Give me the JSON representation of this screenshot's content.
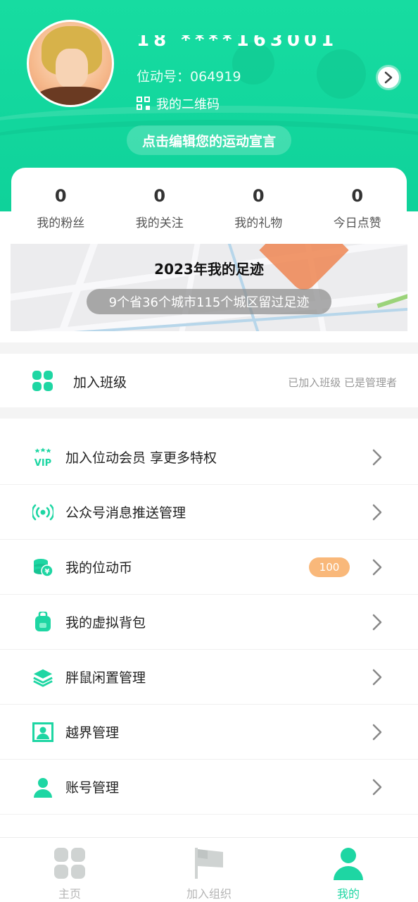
{
  "colors": {
    "primary": "#17dca1",
    "badge": "#f9b87a",
    "text": "#222222",
    "muted": "#999999"
  },
  "header": {
    "nickname": "18 ****163001",
    "uid_text": "位动号：064919",
    "qr_label": "我的二维码",
    "slogan": "点击编辑您的运动宣言",
    "avatar_icon": "avatar",
    "arrow_icon": "chevron-right-icon"
  },
  "stats": [
    {
      "value": "0",
      "label": "我的粉丝"
    },
    {
      "value": "0",
      "label": "我的关注"
    },
    {
      "value": "0",
      "label": "我的礼物"
    },
    {
      "value": "0",
      "label": "今日点赞"
    }
  ],
  "footprint": {
    "title": "2023年我的足迹",
    "subtitle": "9个省36个城市115个城区留过足迹"
  },
  "class_row": {
    "label": "加入班级",
    "status": "已加入班级 已是管理者",
    "icon": "grid-icon"
  },
  "menu": [
    {
      "label": "加入位动会员 享更多特权",
      "icon": "vip-icon"
    },
    {
      "label": "公众号消息推送管理",
      "icon": "broadcast-icon"
    },
    {
      "label": "我的位动币",
      "icon": "coin-icon",
      "badge": "100"
    },
    {
      "label": "我的虚拟背包",
      "icon": "backpack-icon"
    },
    {
      "label": "胖鼠闲置管理",
      "icon": "layers-icon"
    },
    {
      "label": "越界管理",
      "icon": "portrait-icon"
    },
    {
      "label": "账号管理",
      "icon": "user-icon"
    }
  ],
  "tabbar": [
    {
      "label": "主页",
      "icon": "home-grid-icon",
      "active": false
    },
    {
      "label": "加入组织",
      "icon": "flag-icon",
      "active": false
    },
    {
      "label": "我的",
      "icon": "profile-icon",
      "active": true
    }
  ]
}
